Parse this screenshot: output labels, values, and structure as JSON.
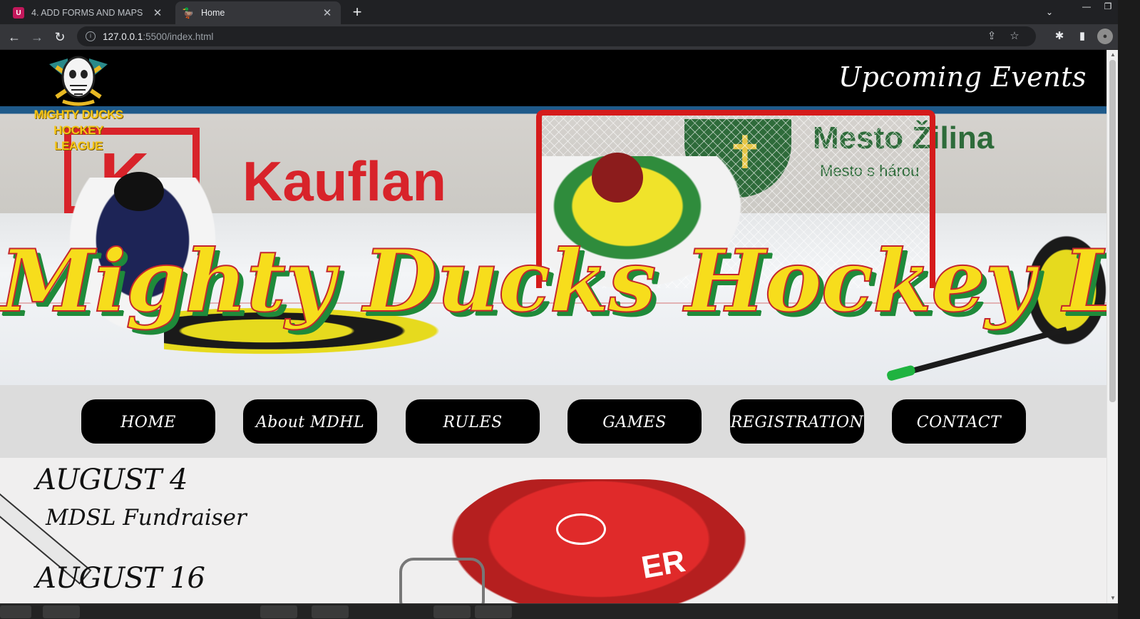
{
  "browser": {
    "tabs": [
      {
        "title": "4. ADD FORMS AND MAPS",
        "favicon": "U"
      },
      {
        "title": "Home",
        "favicon": "duck-logo"
      }
    ],
    "new_tab": "+",
    "address": {
      "host": "127.0.0.1",
      "rest": ":5500/index.html"
    }
  },
  "site": {
    "logo_line1": "MIGHTY DUCKS",
    "logo_line2": "HOCKEY LEAGUE",
    "header_link": "Upcoming Events",
    "hero_title": "Mighty Ducks Hockey League",
    "nav": [
      "HOME",
      "About MDHL",
      "RULES",
      "GAMES",
      "REGISTRATION",
      "CONTACT"
    ],
    "events": [
      {
        "date": "AUGUST 4",
        "name": "MDSL Fundraiser"
      },
      {
        "date": "AUGUST 16",
        "name": ""
      }
    ],
    "colors": {
      "title_fill": "#f7dd1c",
      "title_stroke": "#c4262e",
      "title_shadow": "#1f8a3a",
      "nav_bg": "#000000"
    }
  }
}
